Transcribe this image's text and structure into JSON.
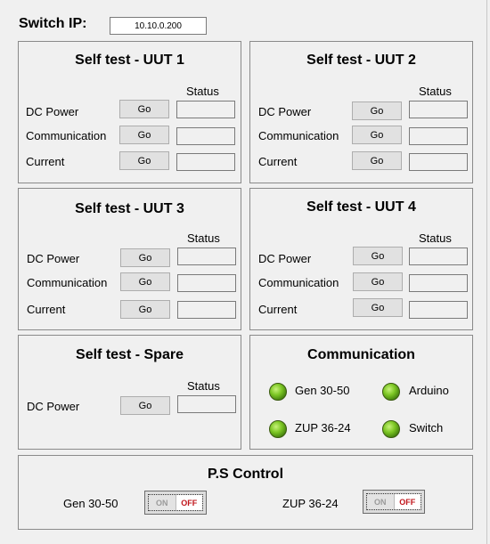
{
  "header": {
    "switch_ip_label": "Switch IP:",
    "switch_ip_value": "10.10.0.200"
  },
  "common": {
    "status_label": "Status",
    "go_label": "Go"
  },
  "uut1": {
    "title": "Self test - UUT 1",
    "rows": [
      "DC Power",
      "Communication",
      "Current"
    ]
  },
  "uut2": {
    "title": "Self test - UUT 2",
    "rows": [
      "DC Power",
      "Communication",
      "Current"
    ]
  },
  "uut3": {
    "title": "Self test - UUT 3",
    "rows": [
      "DC Power",
      "Communication",
      "Current"
    ]
  },
  "uut4": {
    "title": "Self test - UUT 4",
    "rows": [
      "DC Power",
      "Communication",
      "Current"
    ]
  },
  "spare": {
    "title": "Self test - Spare",
    "rows": [
      "DC Power"
    ]
  },
  "communication": {
    "title": "Communication",
    "indicators": [
      "Gen 30-50",
      "Arduino",
      "ZUP 36-24",
      "Switch"
    ],
    "led_color": "#7cc624"
  },
  "ps_control": {
    "title": "P.S Control",
    "items": [
      {
        "label": "Gen 30-50",
        "on": "ON",
        "off": "OFF"
      },
      {
        "label": "ZUP 36-24",
        "on": "ON",
        "off": "OFF"
      }
    ],
    "off_color": "#c0141a"
  }
}
